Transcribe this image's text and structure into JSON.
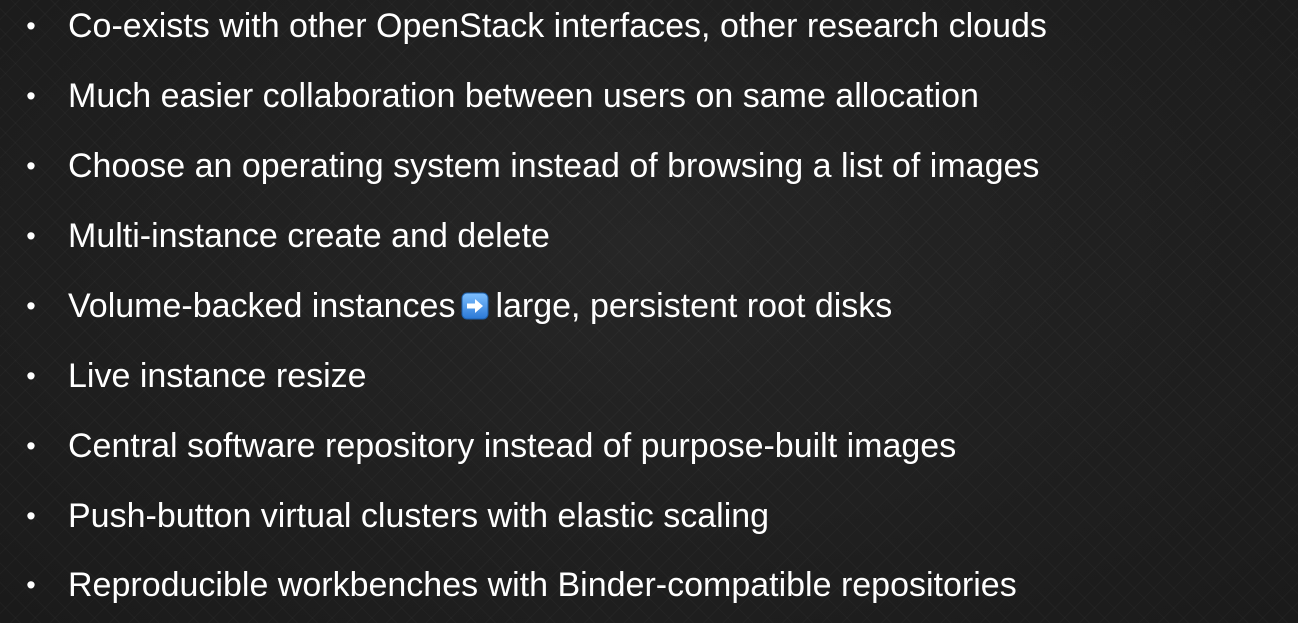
{
  "slide": {
    "bullet_symbol": "•",
    "items": [
      {
        "text": "Co-exists with other OpenStack interfaces, other research clouds"
      },
      {
        "text": "Much easier collaboration between users on same allocation"
      },
      {
        "text": "Choose an operating system instead of browsing a list of images"
      },
      {
        "text": "Multi-instance create and delete"
      },
      {
        "text_before": "Volume-backed instances",
        "icon": "right-arrow-icon",
        "text_after": "large, persistent root disks"
      },
      {
        "text": "Live instance resize"
      },
      {
        "text": "Central software repository instead of purpose-built images"
      },
      {
        "text": "Push-button virtual clusters with elastic scaling"
      },
      {
        "text": "Reproducible workbenches with Binder-compatible repositories"
      }
    ]
  },
  "colors": {
    "background": "#1d1d1d",
    "text": "#ffffff",
    "arrow_icon_fill": "#3a8ee6"
  }
}
